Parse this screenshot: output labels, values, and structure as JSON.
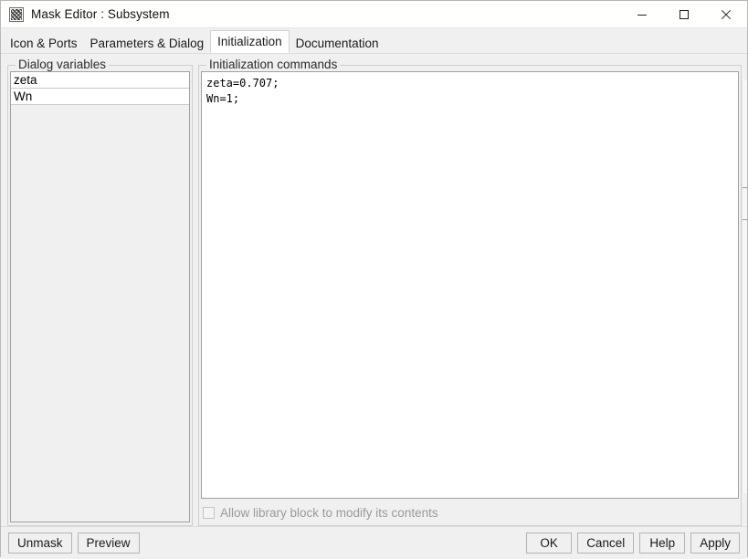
{
  "window": {
    "title": "Mask Editor : Subsystem",
    "icon": "mask-editor-icon",
    "controls": {
      "minimize": "minimize-icon",
      "maximize": "maximize-icon",
      "close": "close-icon"
    }
  },
  "tabs": [
    {
      "label": "Icon & Ports",
      "selected": false
    },
    {
      "label": "Parameters & Dialog",
      "selected": false
    },
    {
      "label": "Initialization",
      "selected": true
    },
    {
      "label": "Documentation",
      "selected": false
    }
  ],
  "dialog_variables": {
    "group_label": "Dialog variables",
    "items": [
      {
        "name": "zeta"
      },
      {
        "name": "Wn"
      }
    ]
  },
  "initialization": {
    "group_label": "Initialization commands",
    "code": "zeta=0.707;\nWn=1;",
    "allow_library_modify": {
      "label": "Allow library block to modify its contents",
      "checked": false,
      "enabled": false
    }
  },
  "footer": {
    "left_buttons": [
      {
        "label": "Unmask"
      },
      {
        "label": "Preview"
      }
    ],
    "right_buttons": [
      {
        "label": "OK"
      },
      {
        "label": "Cancel"
      },
      {
        "label": "Help"
      },
      {
        "label": "Apply"
      }
    ]
  },
  "colors": {
    "window_bg": "#f0f0f0",
    "titlebar_bg": "#fffffe",
    "selected_tab_bg": "#ffffff",
    "field_bg": "#ffffff",
    "border": "#a0a0a0",
    "disabled_text": "#9a9a9a"
  }
}
